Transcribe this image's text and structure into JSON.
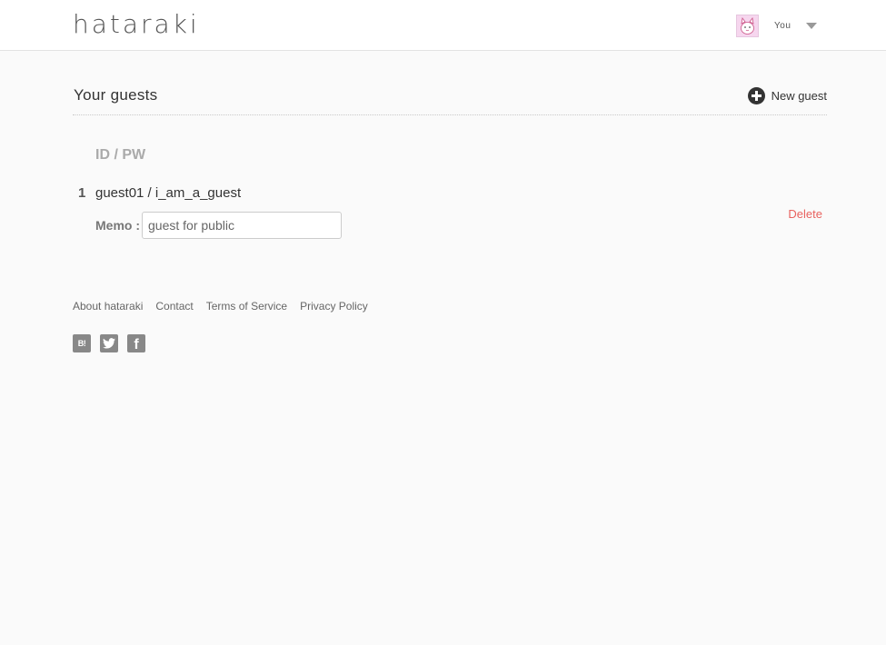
{
  "header": {
    "logo": "hataraki",
    "user": {
      "name": "You",
      "avatar_icon": "cat-avatar-icon",
      "menu_icon": "caret-down-icon"
    }
  },
  "main": {
    "title": "Your guests",
    "new_guest_label": "New guest",
    "new_guest_icon": "plus-circle-icon",
    "column_header": "ID / PW",
    "guests": [
      {
        "number": "1",
        "credentials": "guest01 / i_am_a_guest",
        "memo_label": "Memo :",
        "memo_value": "guest for public",
        "delete_label": "Delete"
      }
    ]
  },
  "footer": {
    "links": [
      "About hataraki",
      "Contact",
      "Terms of Service",
      "Privacy Policy"
    ],
    "social": [
      {
        "icon": "hatena-bookmark-icon",
        "glyph": "B!"
      },
      {
        "icon": "twitter-icon"
      },
      {
        "icon": "facebook-icon",
        "glyph": "f"
      }
    ]
  },
  "colors": {
    "background": "#fafafa",
    "header_bg": "#ffffff",
    "delete": "#e8625f",
    "muted": "#aaaaaa",
    "avatar_bg": "#f6d6ee"
  }
}
